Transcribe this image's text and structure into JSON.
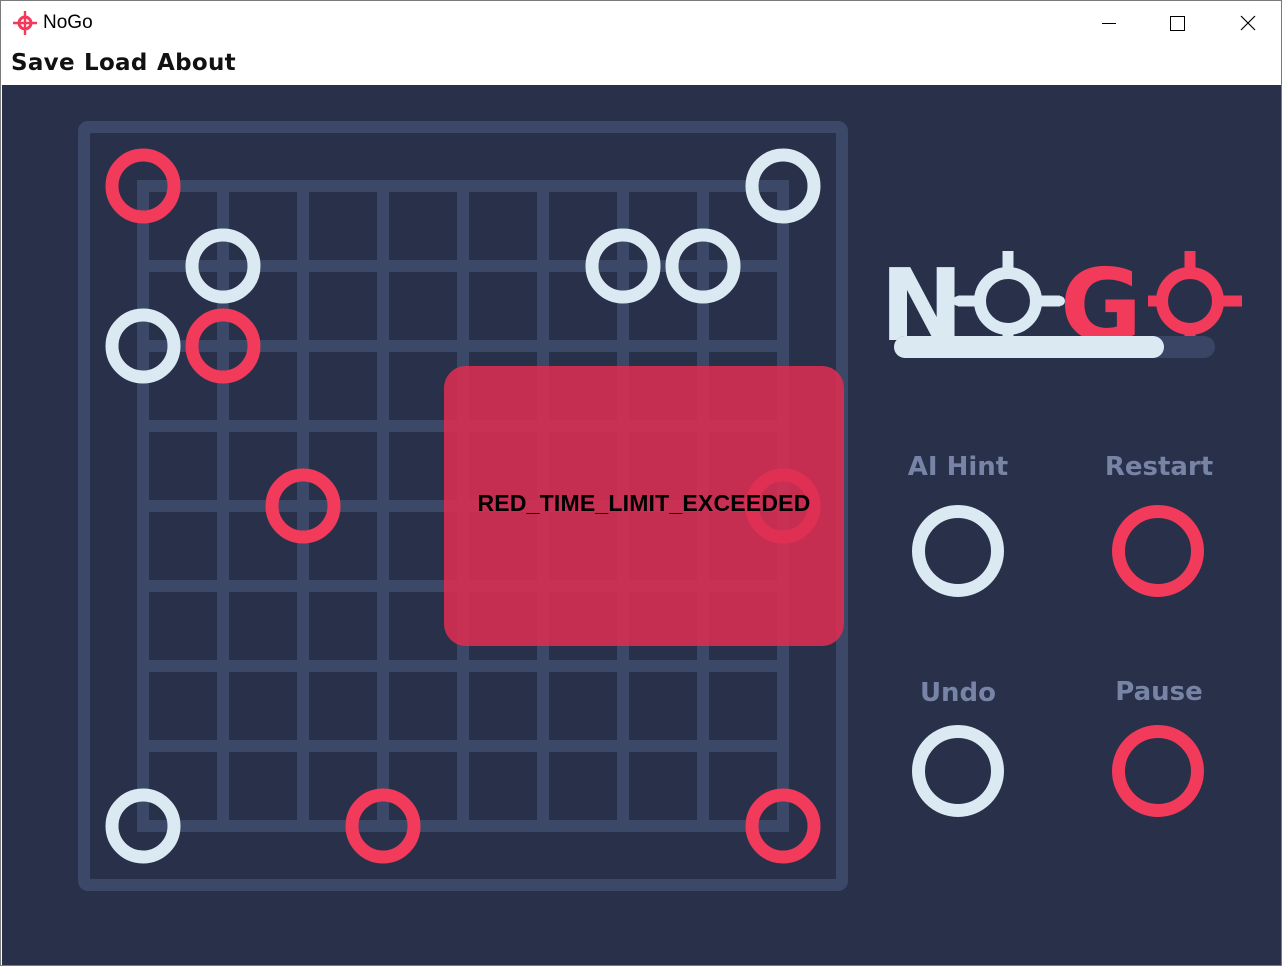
{
  "window": {
    "title": "NoGo",
    "icon": "crosshair-icon",
    "controls": [
      "minimize-icon",
      "maximize-icon",
      "close-icon"
    ]
  },
  "menu": {
    "save": "Save",
    "load": "Load",
    "about": "About"
  },
  "logo": {
    "text_light": "N",
    "text_red": "G",
    "o_glyph_icon": "crosshair-icon",
    "color_light": "#dbe9f2",
    "color_red": "#f23a5a"
  },
  "progress": {
    "fraction": 0.84
  },
  "controls": {
    "ai_hint": "AI Hint",
    "restart": "Restart",
    "undo": "Undo",
    "pause": "Pause"
  },
  "board": {
    "size": 9,
    "stones": [
      {
        "row": 0,
        "col": 0,
        "color": "red"
      },
      {
        "row": 0,
        "col": 8,
        "color": "white"
      },
      {
        "row": 1,
        "col": 1,
        "color": "white"
      },
      {
        "row": 1,
        "col": 6,
        "color": "white"
      },
      {
        "row": 1,
        "col": 7,
        "color": "white"
      },
      {
        "row": 2,
        "col": 0,
        "color": "white"
      },
      {
        "row": 2,
        "col": 1,
        "color": "red"
      },
      {
        "row": 4,
        "col": 2,
        "color": "red"
      },
      {
        "row": 4,
        "col": 8,
        "color": "red"
      },
      {
        "row": 8,
        "col": 0,
        "color": "white"
      },
      {
        "row": 8,
        "col": 3,
        "color": "red"
      },
      {
        "row": 8,
        "col": 8,
        "color": "red"
      }
    ],
    "colors": {
      "red": "#f23a5a",
      "white": "#dbe9f2",
      "grid": "#3c4867",
      "background": "#29304a"
    }
  },
  "overlay": {
    "message": "RED_TIME_LIMIT_EXCEEDED"
  }
}
